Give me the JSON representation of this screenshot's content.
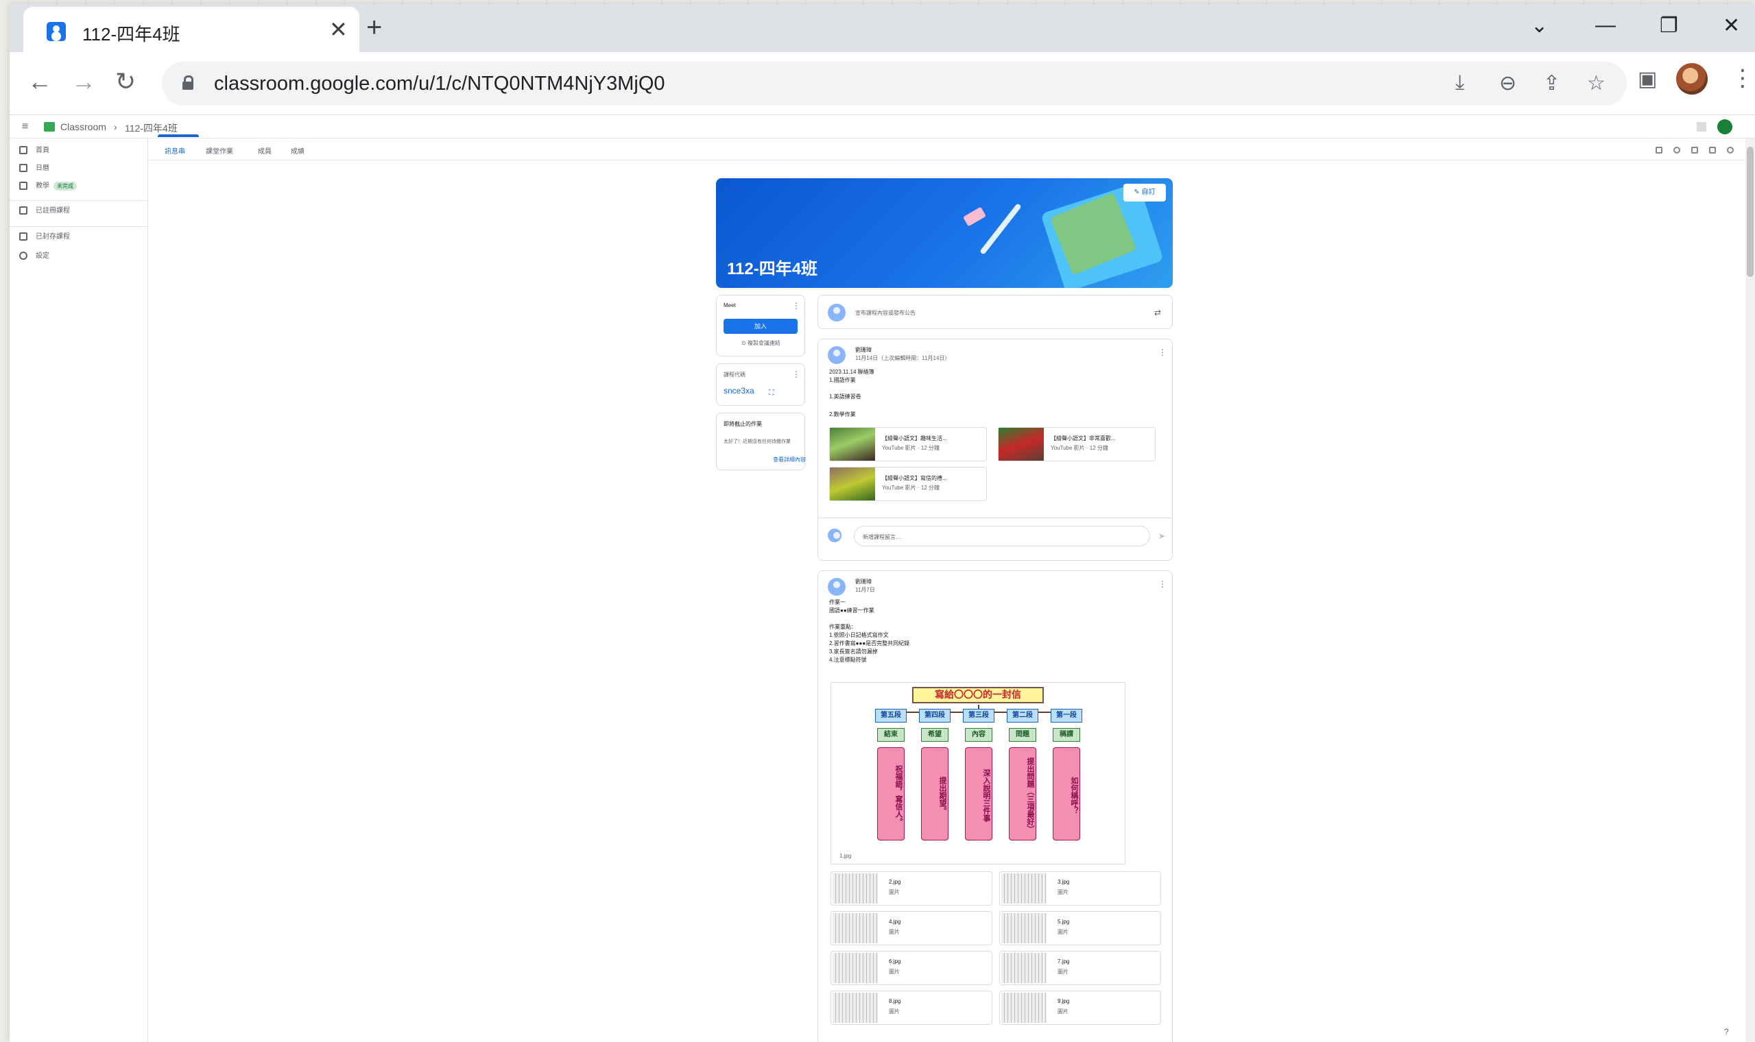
{
  "browser": {
    "tab_title": "112-四年4班",
    "tab_close": "✕",
    "new_tab": "+",
    "url": "classroom.google.com/u/1/c/NTQ0NTM4NjY3MjQ0",
    "window_controls": [
      "⌄",
      "—",
      "❐",
      "✕"
    ],
    "nav_back": "←",
    "nav_forward": "→",
    "nav_reload": "↻",
    "toolbar_icons": [
      "⤓",
      "⊖",
      "⇪",
      "☆",
      "▣"
    ],
    "menu": "⋮"
  },
  "classroom_header": {
    "hamburger": "≡",
    "app_name": "Classroom",
    "separator": "›",
    "class_name": "112-四年4班"
  },
  "sidebar": {
    "items": [
      {
        "label": "首頁",
        "icon": "home-icon"
      },
      {
        "label": "日曆",
        "icon": "calendar-icon"
      },
      {
        "label": "教學",
        "icon": "teaching-icon",
        "badge": "未完成"
      },
      {
        "label": "已註冊課程",
        "icon": "enrolled-icon"
      },
      {
        "label": "已封存課程",
        "icon": "archive-icon"
      },
      {
        "label": "設定",
        "icon": "gear-icon"
      }
    ]
  },
  "subtabs": [
    "訊息串",
    "課堂作業",
    "成員",
    "成績"
  ],
  "banner": {
    "title": "112-四年4班",
    "edit_label": "✎ 自訂",
    "accent": "#1a73e8"
  },
  "meet_card": {
    "title": "Meet",
    "join_label": "加入",
    "footer": "⊙ 複製會議連結"
  },
  "class_code_card": {
    "title": "課程代碼",
    "code": "snce3xa"
  },
  "upcoming_card": {
    "title": "即將截止的作業",
    "body": "太好了！近期沒有任何待繳作業",
    "link": "查看詳細內容"
  },
  "announce_box": {
    "placeholder": "宣布課程內容或發布公告"
  },
  "post1": {
    "author": "劉珊璋",
    "date": "11月14日（上次編輯時間：11月14日）",
    "lines": [
      "2023.11.14 聯絡簿",
      "1.國語作業",
      "1.英語練習卷",
      "2.數學作業"
    ],
    "videos": [
      {
        "title": "【繪聲小語文】趣味生活...",
        "meta": "YouTube 影片 · 12 分鐘"
      },
      {
        "title": "【繪聲小語文】非常喜歡...",
        "meta": "YouTube 影片 · 12 分鐘"
      },
      {
        "title": "【繪聲小語文】寫信的禮...",
        "meta": "YouTube 影片 · 12 分鐘"
      }
    ],
    "comment_placeholder": "新增課程留言…"
  },
  "post2": {
    "author": "劉珊璋",
    "date": "11月7日",
    "lines": [
      "作業一",
      "國語●●練習一作業",
      "作業重點：",
      "1.依照小日記格式寫作文",
      "2.習作書寫●●●是否完整共同紀錄",
      "3.家長簽名請勿漏掉",
      "4.注意標點符號"
    ],
    "diagram": {
      "title": "寫給〇〇〇的一封信",
      "headers": [
        "第五段",
        "第四段",
        "第三段",
        "第二段",
        "第一段"
      ],
      "subs": [
        "結束",
        "希望",
        "內容",
        "問題",
        "稱謂"
      ],
      "bodies": [
        "祝福語，寫信人。",
        "提出期望。",
        "深入說明三件事",
        "提出問題（三項最好）",
        "如何稱呼？"
      ],
      "caption": "1.jpg"
    },
    "attachments": [
      {
        "name": "2.jpg",
        "type": "圖片"
      },
      {
        "name": "3.jpg",
        "type": "圖片"
      },
      {
        "name": "4.jpg",
        "type": "圖片"
      },
      {
        "name": "5.jpg",
        "type": "圖片"
      },
      {
        "name": "6.jpg",
        "type": "圖片"
      },
      {
        "name": "7.jpg",
        "type": "圖片"
      },
      {
        "name": "8.jpg",
        "type": "圖片"
      },
      {
        "name": "9.jpg",
        "type": "圖片"
      }
    ]
  },
  "help_icon": "?"
}
